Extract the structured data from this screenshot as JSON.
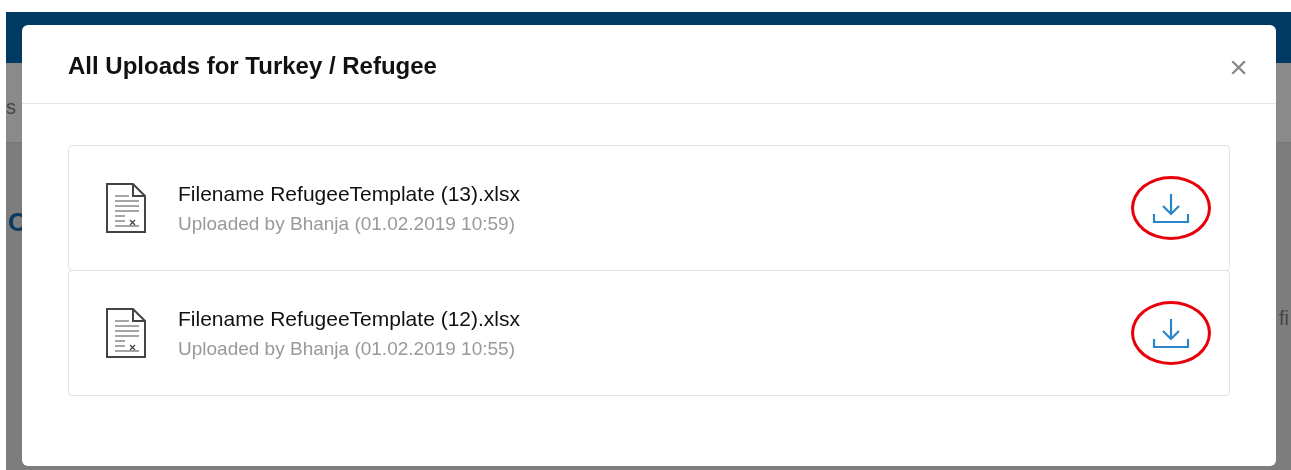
{
  "background_page": {
    "fragments": [
      "s",
      "C",
      "fi"
    ]
  },
  "dialog": {
    "title": "All Uploads for Turkey / Refugee",
    "close": "×",
    "uploads": [
      {
        "filename": "Filename RefugeeTemplate (13).xlsx",
        "meta": "Uploaded by Bhanja (01.02.2019 10:59)",
        "highlighted": true
      },
      {
        "filename": "Filename RefugeeTemplate (12).xlsx",
        "meta": "Uploaded by Bhanja (01.02.2019 10:55)",
        "highlighted": true
      }
    ]
  }
}
